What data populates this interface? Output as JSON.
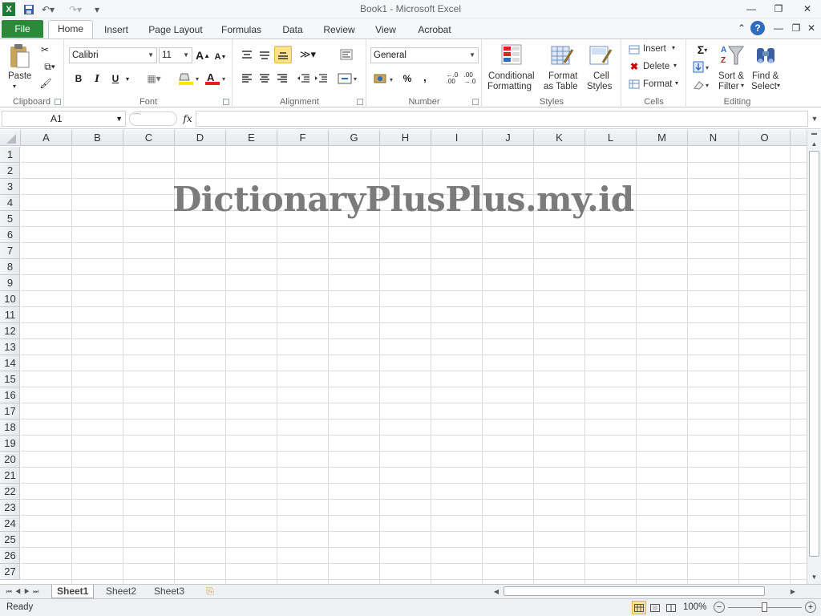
{
  "window": {
    "title": "Book1  -  Microsoft Excel"
  },
  "tabs": [
    "File",
    "Home",
    "Insert",
    "Page Layout",
    "Formulas",
    "Data",
    "Review",
    "View",
    "Acrobat"
  ],
  "clipboard": {
    "paste": "Paste",
    "group": "Clipboard"
  },
  "font": {
    "name": "Calibri",
    "size": "11",
    "group": "Font",
    "bold": "B",
    "italic": "I",
    "underline": "U"
  },
  "alignment": {
    "group": "Alignment"
  },
  "number": {
    "format": "General",
    "percent": "%",
    "comma": ",",
    "group": "Number"
  },
  "styles": {
    "conditional": "Conditional",
    "formatting": "Formatting",
    "format_as": "Format",
    "as_table": "as Table",
    "cell": "Cell",
    "styles": "Styles",
    "group": "Styles"
  },
  "cells": {
    "insert": "Insert",
    "delete": "Delete",
    "format": "Format",
    "group": "Cells"
  },
  "editing": {
    "sort1": "Sort &",
    "sort2": "Filter",
    "find1": "Find &",
    "find2": "Select",
    "group": "Editing"
  },
  "formula_bar": {
    "name_box": "A1",
    "fx": "fx",
    "value": ""
  },
  "columns": [
    "A",
    "B",
    "C",
    "D",
    "E",
    "F",
    "G",
    "H",
    "I",
    "J",
    "K",
    "L",
    "M",
    "N",
    "O"
  ],
  "rows": [
    "1",
    "2",
    "3",
    "4",
    "5",
    "6",
    "7",
    "8",
    "9",
    "10",
    "11",
    "12",
    "13",
    "14",
    "15",
    "16",
    "17",
    "18",
    "19",
    "20",
    "21",
    "22",
    "23",
    "24",
    "25",
    "26",
    "27"
  ],
  "watermark": "DictionaryPlusPlus.my.id",
  "sheets": [
    "Sheet1",
    "Sheet2",
    "Sheet3"
  ],
  "status": {
    "ready": "Ready",
    "zoom": "100%"
  },
  "colors": {
    "file_tab": "#2a8a3a",
    "grid": "#dadcdd",
    "watermark": "#7b7b7b"
  }
}
